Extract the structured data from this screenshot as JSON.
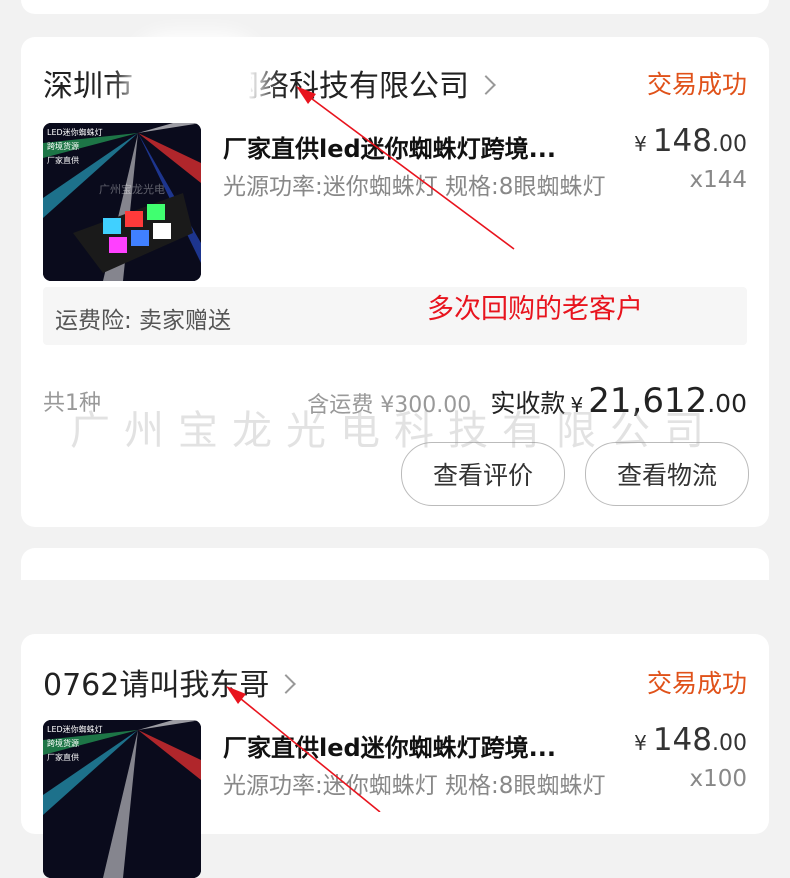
{
  "orders": [
    {
      "shop": "深圳市",
      "shop_rest": "网络科技有限公司",
      "status": "交易成功",
      "thumb_caption": [
        "LED迷你蜘蛛灯",
        "跨境货源",
        "厂家直供"
      ],
      "title": "厂家直供led迷你蜘蛛灯跨境...",
      "currency": "¥",
      "price_int": "148",
      "price_dec": ".00",
      "spec": "光源功率:迷你蜘蛛灯 规格:8眼蜘蛛灯",
      "qty": "x144",
      "insurance": "运费险:  卖家赠送",
      "annotation": "多次回购的老客户",
      "count": "共1种",
      "shipping_label": "含运费",
      "shipping": "300.00",
      "paid_label": "实收款",
      "paid_int": "21,612",
      "paid_dec": ".00",
      "buttons": [
        "查看评价",
        "查看物流"
      ]
    },
    {
      "shop": "0762请叫我东哥",
      "status": "交易成功",
      "thumb_caption": [
        "LED迷你蜘蛛灯",
        "跨境货源",
        "厂家直供"
      ],
      "title": "厂家直供led迷你蜘蛛灯跨境...",
      "currency": "¥",
      "price_int": "148",
      "price_dec": ".00",
      "spec": "光源功率:迷你蜘蛛灯 规格:8眼蜘蛛灯",
      "qty": "x100"
    }
  ],
  "watermark": "广州宝龙光电科技有限公司",
  "thumb_watermark": "广州宝龙光电",
  "colors": {
    "status": "#e0521a",
    "annotation": "#e8141e",
    "background": "#f2f2f2"
  }
}
